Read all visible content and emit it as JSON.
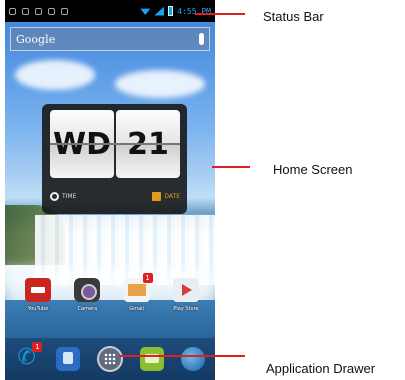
{
  "phone": {
    "status_bar": {
      "time": "4:55 PM"
    },
    "search": {
      "label": "Google"
    },
    "clock_widget": {
      "left_card": "WD",
      "right_card": "21",
      "time_button": "TIME",
      "date_button": "DATE"
    },
    "apps": [
      {
        "label": "YouTube",
        "icon": "youtube-icon"
      },
      {
        "label": "Camera",
        "icon": "camera-icon"
      },
      {
        "label": "Gmail",
        "icon": "gmail-icon",
        "badge": "1"
      },
      {
        "label": "Play Store",
        "icon": "playstore-icon"
      }
    ],
    "dock": [
      {
        "icon": "phone-icon",
        "badge": "1"
      },
      {
        "icon": "contacts-icon"
      },
      {
        "icon": "app-drawer-icon"
      },
      {
        "icon": "messaging-icon"
      },
      {
        "icon": "browser-icon"
      }
    ]
  },
  "callouts": {
    "status_bar": "Status Bar",
    "home_screen": "Home Screen",
    "app_drawer": "Application Drawer"
  },
  "colors": {
    "callout_line": "#e02020",
    "status_accent": "#1ea1f2",
    "date_accent": "#e29b1a"
  }
}
